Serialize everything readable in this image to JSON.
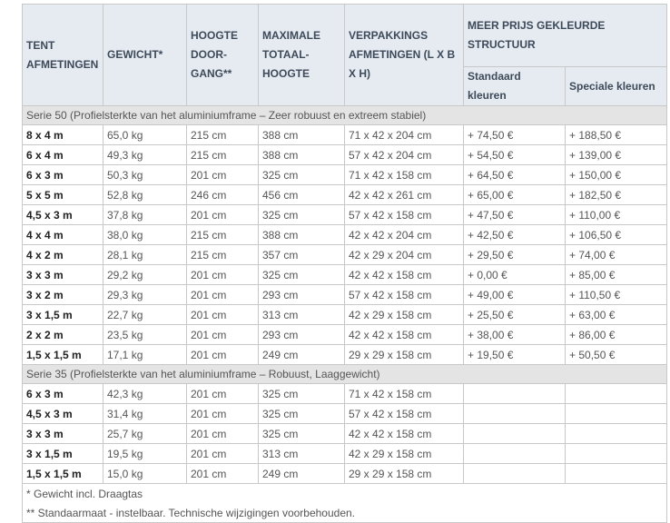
{
  "headers": {
    "tent": "TENT AFMETINGEN",
    "gewicht": "GEWICHT*",
    "hoogte": "HOOGTE DOOR-GANG**",
    "maximale": "MAXIMALE TOTAAL-HOOGTE",
    "verpakking": "VERPAKKINGS AFMETINGEN (L X B X H)",
    "meerprijs": "MEER PRIJS GEKLEURDE STRUCTUUR",
    "standaard": "Standaard kleuren",
    "speciale": "Speciale kleuren"
  },
  "series50": {
    "label": "Serie 50 (Profielsterkte van het aluminiumframe – Zeer robuust en extreem stabiel)",
    "rows": [
      [
        "8 x 4 m",
        "65,0 kg",
        "215 cm",
        "388 cm",
        "71 x 42 x 204 cm",
        "+ 74,50 €",
        "+ 188,50 €"
      ],
      [
        "6 x 4 m",
        "49,3 kg",
        "215 cm",
        "388 cm",
        "57 x 42 x 204 cm",
        "+ 54,50 €",
        "+ 139,00 €"
      ],
      [
        "6 x 3 m",
        "50,3 kg",
        "201 cm",
        "325 cm",
        "71 x 42 x 158 cm",
        "+ 64,50 €",
        "+ 150,00 €"
      ],
      [
        "5 x 5 m",
        "52,8 kg",
        "246 cm",
        "456 cm",
        "42 x 42 x 261 cm",
        "+ 65,00 €",
        "+ 182,50 €"
      ],
      [
        "4,5 x 3 m",
        "37,8 kg",
        "201 cm",
        "325 cm",
        "57 x 42 x 158 cm",
        "+ 47,50 €",
        "+ 110,00 €"
      ],
      [
        "4 x 4 m",
        "38,0 kg",
        "215 cm",
        "388 cm",
        "42 x 42 x 204 cm",
        "+ 42,50 €",
        "+ 106,50 €"
      ],
      [
        "4 x 2 m",
        "28,1 kg",
        "215 cm",
        "357 cm",
        "42 x 29 x 204 cm",
        "+ 29,50 €",
        "+ 74,00 €"
      ],
      [
        "3 x 3 m",
        "29,2 kg",
        "201 cm",
        "325 cm",
        "42 x 42 x 158 cm",
        "+ 0,00 €",
        "+ 85,00 €"
      ],
      [
        "3 x 2 m",
        "29,3 kg",
        "201 cm",
        "293 cm",
        "57 x 42 x 158 cm",
        "+ 49,00 €",
        "+ 110,50 €"
      ],
      [
        "3 x 1,5 m",
        "22,7 kg",
        "201 cm",
        "313 cm",
        "42 x 29 x 158 cm",
        "+ 25,50 €",
        "+ 63,00 €"
      ],
      [
        "2 x 2 m",
        "23,5 kg",
        "201 cm",
        "293 cm",
        "42 x 42 x 158 cm",
        "+ 38,00 €",
        "+ 86,00 €"
      ],
      [
        "1,5 x 1,5 m",
        "17,1 kg",
        "201 cm",
        "249 cm",
        "29 x 29 x 158 cm",
        "+ 19,50 €",
        "+ 50,50 €"
      ]
    ]
  },
  "series35": {
    "label": "Serie 35 (Profielsterkte van het aluminiumframe – Robuust, Laaggewicht)",
    "rows": [
      [
        "6 x 3 m",
        "42,3 kg",
        "201 cm",
        "325 cm",
        "71 x 42 x 158 cm",
        "",
        ""
      ],
      [
        "4,5 x 3 m",
        "31,4 kg",
        "201 cm",
        "325 cm",
        "57 x 42 x 158 cm",
        "",
        ""
      ],
      [
        "3 x 3 m",
        "25,7 kg",
        "201 cm",
        "325 cm",
        "42 x 42 x 158 cm",
        "",
        ""
      ],
      [
        "3 x 1,5 m",
        "19,5 kg",
        "201 cm",
        "313 cm",
        "42 x 29 x 158 cm",
        "",
        ""
      ],
      [
        "1,5 x 1,5 m",
        "15,0 kg",
        "201 cm",
        "249 cm",
        "29 x 29 x 158 cm",
        "",
        ""
      ]
    ]
  },
  "footnotes": [
    "* Gewicht incl. Draagtas",
    "** Standaarmaat - instelbaar. Technische wijzigingen voorbehouden."
  ]
}
